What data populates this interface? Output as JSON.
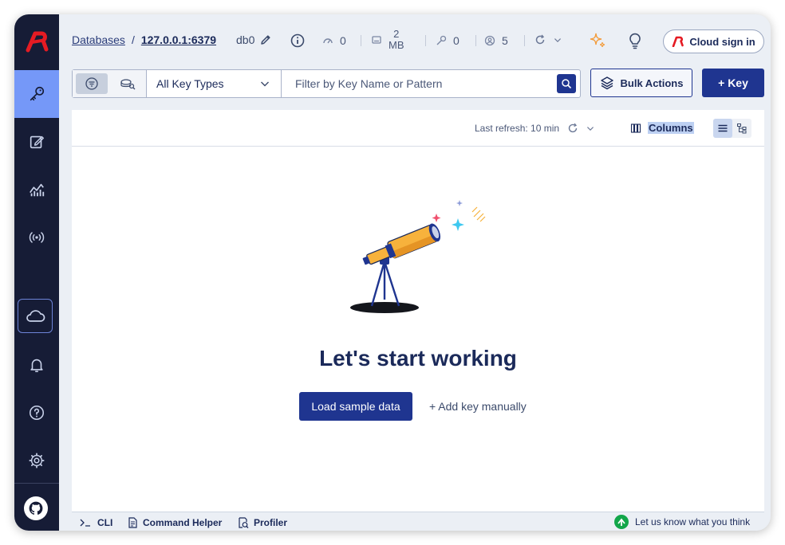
{
  "breadcrumb": {
    "databases": "Databases",
    "separator": "/",
    "host": "127.0.0.1:6379"
  },
  "db": {
    "name": "db0"
  },
  "stats": {
    "cpu": "0",
    "memory_value": "2",
    "memory_unit": "MB",
    "keys": "0",
    "clients": "5"
  },
  "cloud": {
    "signin_label": "Cloud sign in"
  },
  "filter": {
    "key_type": "All Key Types",
    "search_placeholder": "Filter by Key Name or Pattern"
  },
  "actions": {
    "bulk": "Bulk Actions",
    "add_key": "+ Key"
  },
  "list_header": {
    "refresh": "Last refresh: 10 min",
    "columns": "Columns"
  },
  "empty": {
    "headline": "Let's start working",
    "load_sample": "Load sample data",
    "add_manually": "+ Add key manually"
  },
  "footer": {
    "cli": "CLI",
    "command_helper": "Command Helper",
    "profiler": "Profiler",
    "feedback": "Let us know what you think"
  },
  "colors": {
    "sidebar": "#161c36",
    "sidebar_active": "#7598f8",
    "primary": "#1f3590",
    "background": "#ebeff5",
    "brand_red": "#e51b23",
    "feedback_green": "#12a64a"
  },
  "icons": {
    "sidebar": [
      "key-icon",
      "edit-icon",
      "analysis-icon",
      "pubsub-icon",
      "cloud-icon",
      "bell-icon",
      "help-icon",
      "settings-icon",
      "github-icon"
    ],
    "toolbar": [
      "pencil-icon",
      "info-icon",
      "gauge-icon",
      "memory-icon",
      "key-icon",
      "clients-icon",
      "refresh-icon",
      "sparkle-icon",
      "bulb-icon"
    ]
  }
}
